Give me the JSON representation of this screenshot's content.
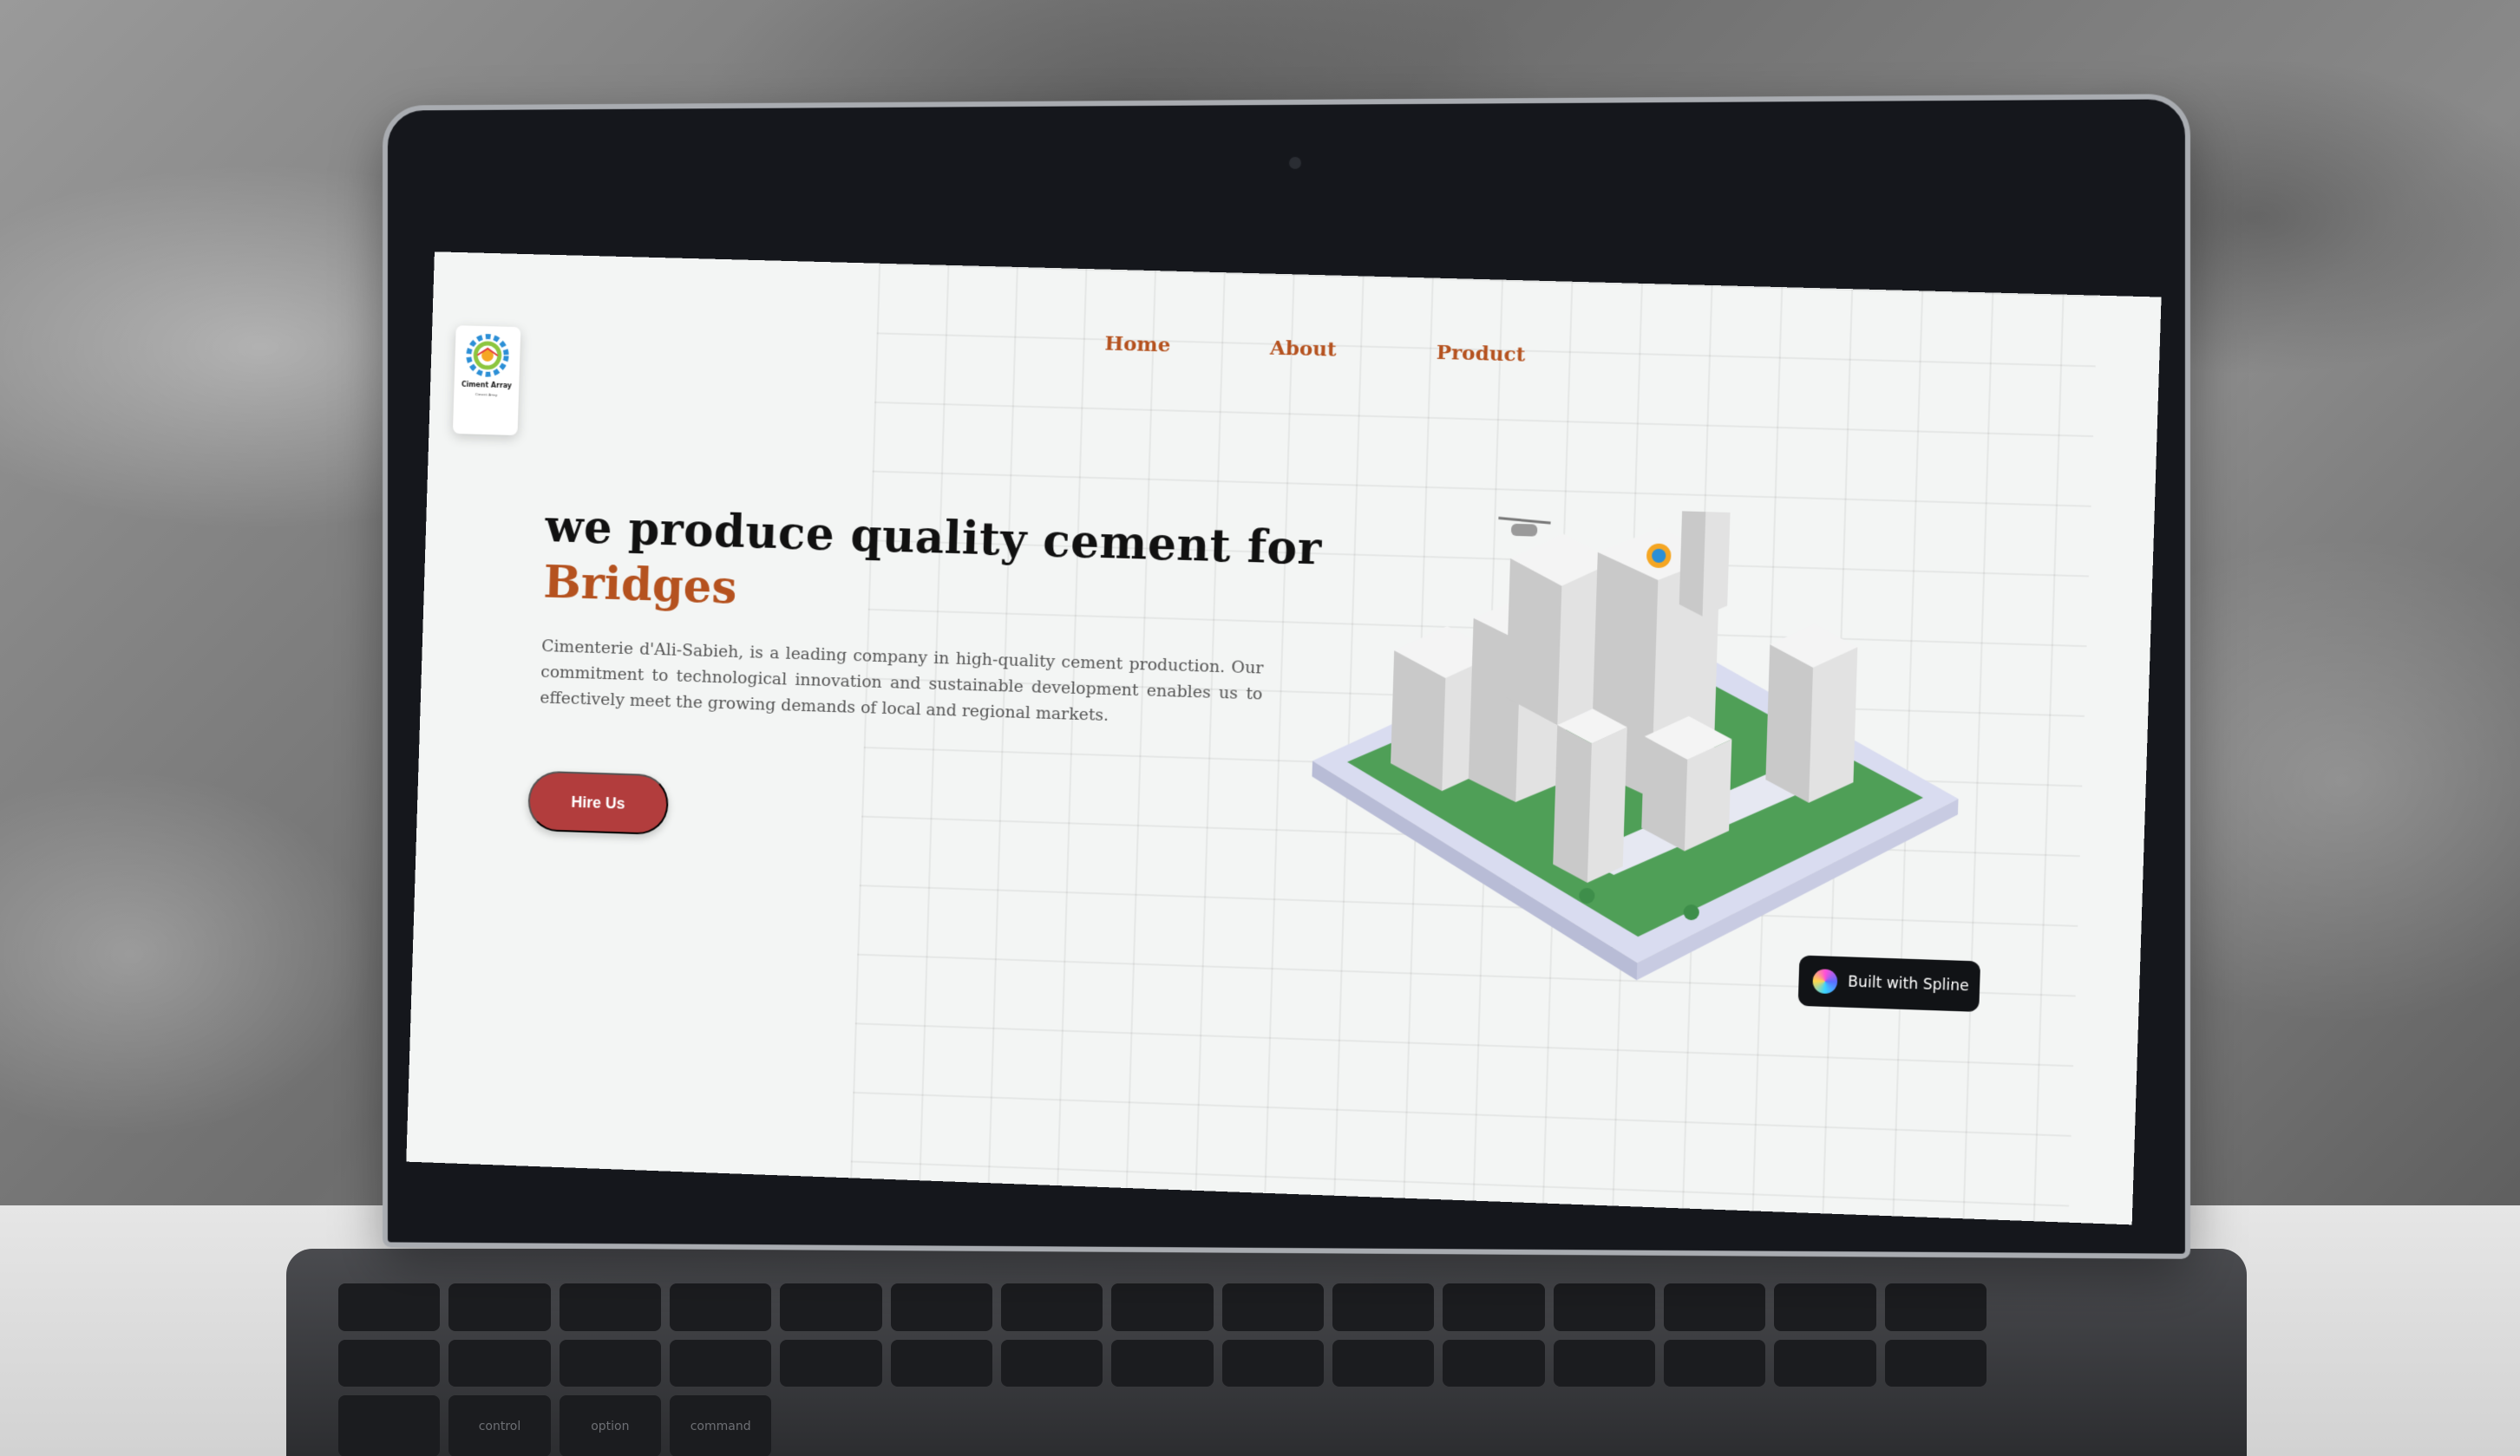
{
  "nav": {
    "items": [
      "Home",
      "About",
      "Product"
    ]
  },
  "logo": {
    "name": "Ciment Array",
    "fine_print": "Ciment Array",
    "gear_colors": [
      "#2c8fd6",
      "#8cc63f",
      "#e23b3b",
      "#f5a623"
    ]
  },
  "hero": {
    "headline": "we produce quality cement for",
    "accent_word": "Bridges",
    "description": "Cimenterie d'Ali-Sabieh, is a leading company in high-quality cement production. Our commitment to technological innovation and sustainable development enables us to effectively meet the growing demands of local and regional markets.",
    "cta_label": "Hire Us"
  },
  "badge": {
    "label": "Built with Spline"
  },
  "colors": {
    "accent": "#b5521f",
    "button": "#b23d3d",
    "background": "#f3f5f4"
  },
  "keyboard": {
    "labels": [
      "control",
      "option",
      "command"
    ]
  }
}
